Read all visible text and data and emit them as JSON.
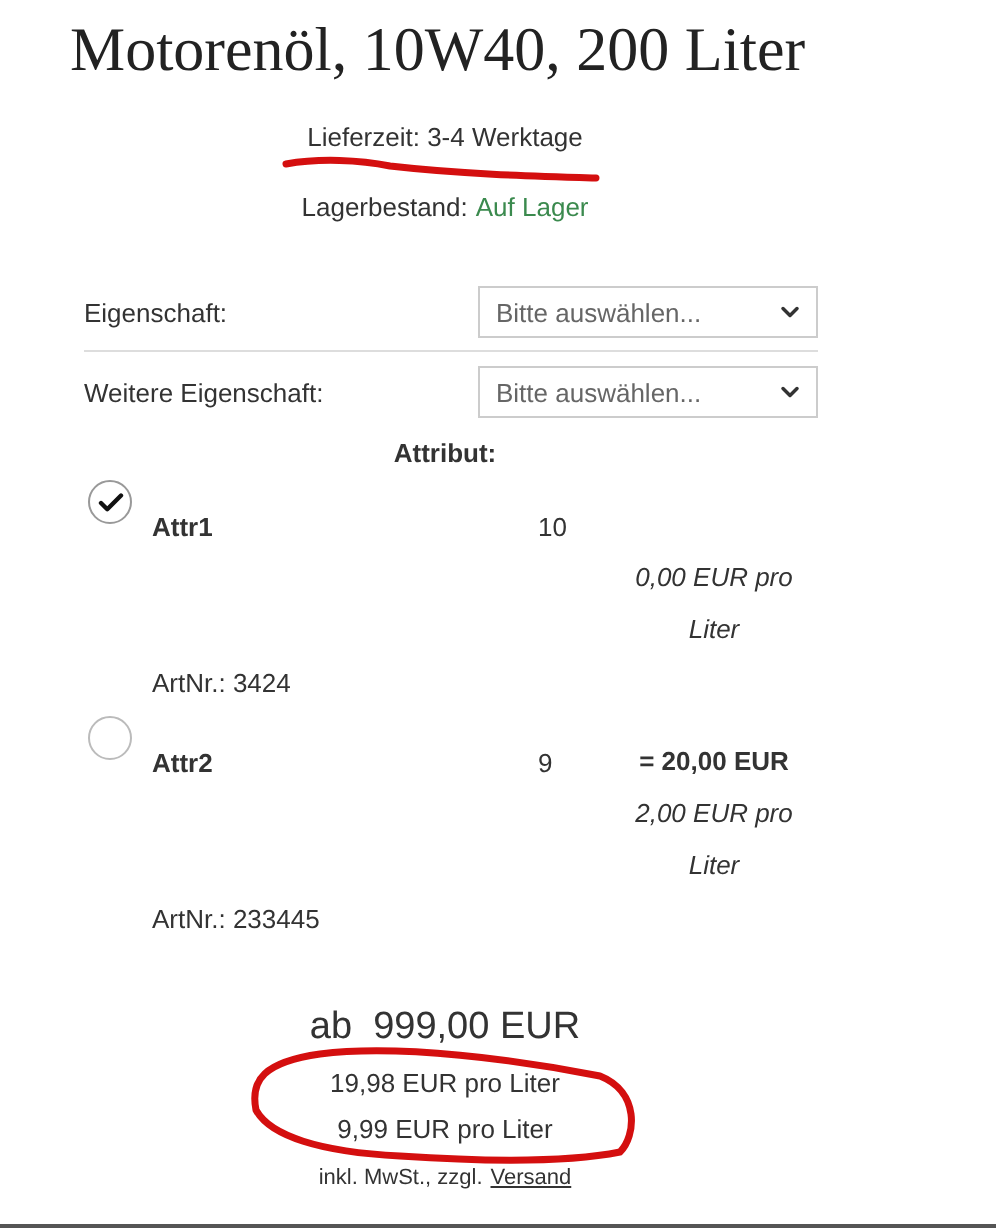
{
  "title": "Motorenöl, 10W40, 200 Liter",
  "delivery": {
    "text": "Lieferzeit: 3-4 Werktage",
    "underlined": true
  },
  "stock": {
    "label": "Lagerbestand:",
    "value": "Auf Lager"
  },
  "options": [
    {
      "label": "Eigenschaft:",
      "placeholder": "Bitte auswählen..."
    },
    {
      "label": "Weitere Eigenschaft:",
      "placeholder": "Bitte auswählen..."
    }
  ],
  "attributes": {
    "heading": "Attribut:",
    "items": [
      {
        "name": "Attr1",
        "quantity": "10",
        "price_per": "0,00 EUR pro Liter",
        "article": "ArtNr.: 3424",
        "selected": true
      },
      {
        "name": "Attr2",
        "quantity": "9",
        "total": "= 20,00 EUR",
        "price_per": "2,00 EUR pro Liter",
        "article": "ArtNr.: 233445",
        "selected": false
      }
    ]
  },
  "price": {
    "main": "ab  999,00 EUR",
    "unit_prices": [
      "19,98 EUR pro Liter",
      "9,99 EUR pro Liter"
    ],
    "tax_note": "inkl. MwSt., zzgl.",
    "shipping_link": "Versand",
    "circled": true
  }
}
